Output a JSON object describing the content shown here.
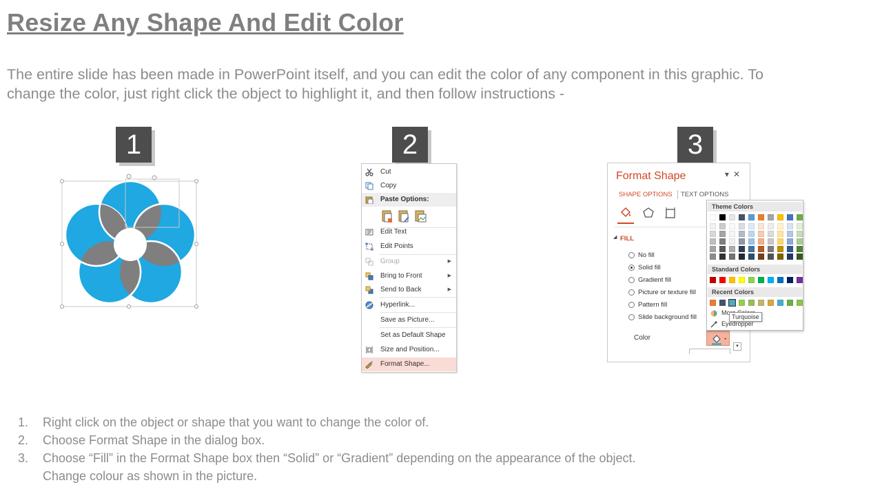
{
  "title": "Resize Any Shape And Edit Color",
  "intro": "The entire slide has been made in PowerPoint itself, and you can edit the color of any component in this graphic. To change the color, just right click the object to highlight it, and then follow instructions -",
  "steps": [
    "1",
    "2",
    "3"
  ],
  "context_menu": {
    "items": [
      {
        "label": "Cut",
        "icon": "scissors-icon"
      },
      {
        "label": "Copy",
        "icon": "copy-icon"
      },
      {
        "label": "Paste Options:",
        "icon": "paste-icon"
      },
      {
        "label": "Edit Text",
        "icon": "edit-text-icon"
      },
      {
        "label": "Edit Points",
        "icon": "edit-points-icon"
      },
      {
        "label": "Group",
        "icon": "group-icon"
      },
      {
        "label": "Bring to Front",
        "icon": "bring-front-icon"
      },
      {
        "label": "Send to Back",
        "icon": "send-back-icon"
      },
      {
        "label": "Hyperlink...",
        "icon": "hyperlink-icon"
      },
      {
        "label": "Save as Picture..."
      },
      {
        "label": "Set as Default Shape"
      },
      {
        "label": "Size and Position...",
        "icon": "size-position-icon"
      },
      {
        "label": "Format Shape...",
        "icon": "format-shape-icon"
      }
    ]
  },
  "format_pane": {
    "title": "Format Shape",
    "tabs": [
      "SHAPE OPTIONS",
      "TEXT OPTIONS"
    ],
    "section": "FILL",
    "options": [
      "No fill",
      "Solid fill",
      "Gradient fill",
      "Picture or texture fill",
      "Pattern fill",
      "Slide background fill"
    ],
    "selected_option": "Solid fill",
    "color_label": "Color"
  },
  "palette": {
    "theme_colors_label": "Theme Colors",
    "standard_colors_label": "Standard Colors",
    "recent_colors_label": "Recent Colors",
    "more_colors": "More Colors...",
    "eyedropper": "Eyedropper",
    "tooltip": "Turquoise",
    "theme_colors": [
      "#ffffff",
      "#000000",
      "#e7e6e6",
      "#44546a",
      "#5b9bd5",
      "#ed7d31",
      "#a5a5a5",
      "#ffc000",
      "#4472c4",
      "#70ad47"
    ],
    "standard_colors": [
      "#c00000",
      "#ff0000",
      "#ffc000",
      "#ffff00",
      "#92d050",
      "#00b050",
      "#00b0f0",
      "#0070c0",
      "#002060",
      "#7030a0"
    ],
    "recent_colors": [
      "#ed7d31",
      "#44546a",
      "#4bacc6",
      "#92d050",
      "#9bbb59",
      "#c3b56b",
      "#d4a843",
      "#4bacc6",
      "#70ad47",
      "#8fc24f"
    ]
  },
  "instructions": [
    "Right click on the object or shape that you want to change the color of.",
    "Choose Format Shape in the dialog box.",
    "Choose “Fill” in the Format Shape box then “Solid” or “Gradient” depending  on the appearance of the object. Change colour as shown in the picture."
  ],
  "colors": {
    "accent": "#d24726",
    "petal": "#1fa8e1",
    "overlap": "#7f7f7f"
  }
}
